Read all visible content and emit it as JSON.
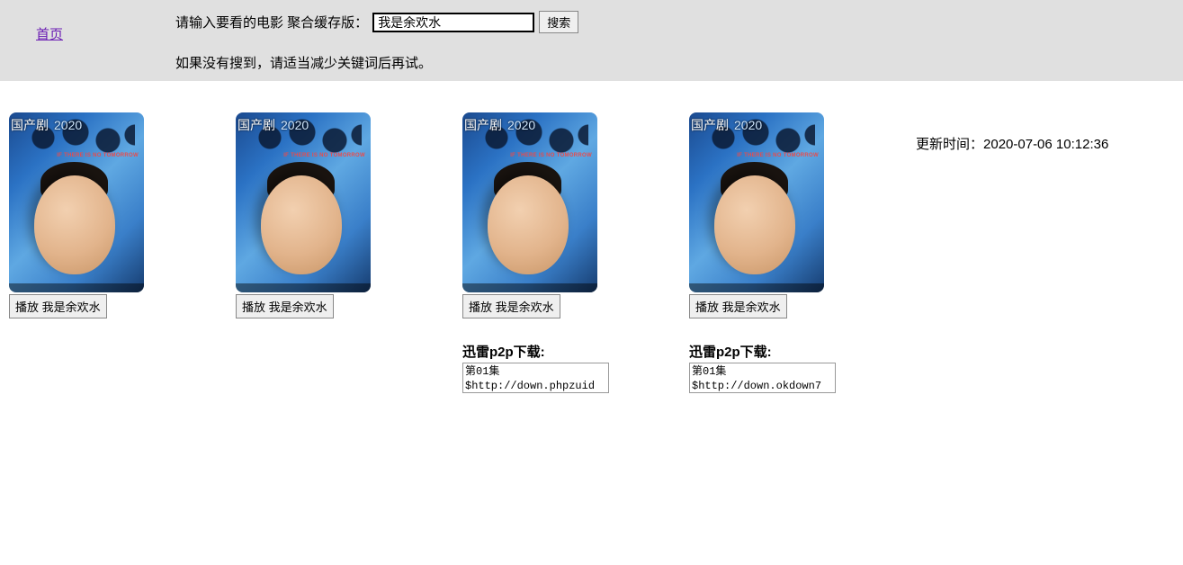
{
  "header": {
    "home_label": "首页",
    "search_prompt": "请输入要看的电影 聚合缓存版：",
    "search_value": "我是余欢水",
    "search_btn": "搜索",
    "hint": "如果没有搜到，请适当减少关键词后再试。"
  },
  "poster": {
    "category": "国产剧",
    "year": "2020",
    "subtitle": "IF THERE IS NO TOMORROW"
  },
  "cards": [
    {
      "play_label": "播放 我是余欢水"
    },
    {
      "play_label": "播放 我是余欢水"
    },
    {
      "play_label": "播放 我是余欢水",
      "download_label": "迅雷p2p下载:",
      "download_text": "第01集$http://down.phpzuid"
    },
    {
      "play_label": "播放 我是余欢水",
      "download_label": "迅雷p2p下载:",
      "download_text": "第01集$http://down.okdown7"
    }
  ],
  "update": {
    "label": "更新时间：",
    "time": "2020-07-06 10:12:36"
  }
}
